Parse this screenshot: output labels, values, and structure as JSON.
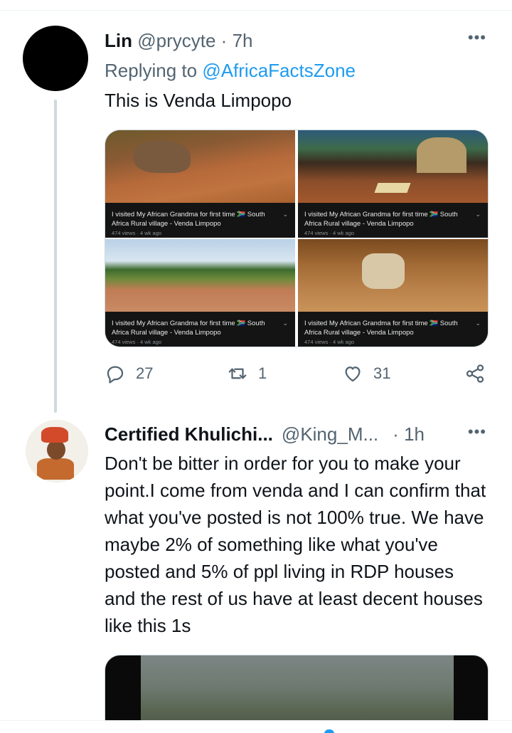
{
  "tweet1": {
    "name": "Lin",
    "handle": "@prycyte",
    "dot": "·",
    "time": "7h",
    "more": "•••",
    "replying_to_prefix": "Replying to ",
    "replying_to_handle": "@AfricaFactsZone",
    "text": "This is Venda Limpopo",
    "media": [
      {
        "caption": "I visited My African Grandma for first time 🇿🇦 South Africa Rural village - Venda Limpopo",
        "meta": "474 views · 4 wk ago"
      },
      {
        "caption": "I visited My African Grandma for first time 🇿🇦 South Africa Rural village - Venda Limpopo",
        "meta": "474 views · 4 wk ago"
      },
      {
        "caption": "I visited My African Grandma for first time 🇿🇦 South Africa Rural village - Venda Limpopo",
        "meta": "474 views · 4 wk ago"
      },
      {
        "caption": "I visited My African Grandma for first time 🇿🇦 South Africa Rural village - Venda Limpopo",
        "meta": "474 views · 4 wk ago"
      }
    ],
    "actions": {
      "replies": "27",
      "retweets": "1",
      "likes": "31"
    }
  },
  "tweet2": {
    "name": "Certified Khulichi...",
    "handle": "@King_M...",
    "dot": "·",
    "time": "1h",
    "more": "•••",
    "text": "Don't be bitter in order for you to make your point.I come from venda and I can confirm that what you've posted is not 100% true. We have maybe 2% of something like what you've posted and 5% of ppl living in RDP houses and the rest of us have at least decent houses like this 1s"
  },
  "colors": {
    "link": "#1d9bf0",
    "secondary_text": "#536471",
    "thread_line": "#cfd9de"
  }
}
